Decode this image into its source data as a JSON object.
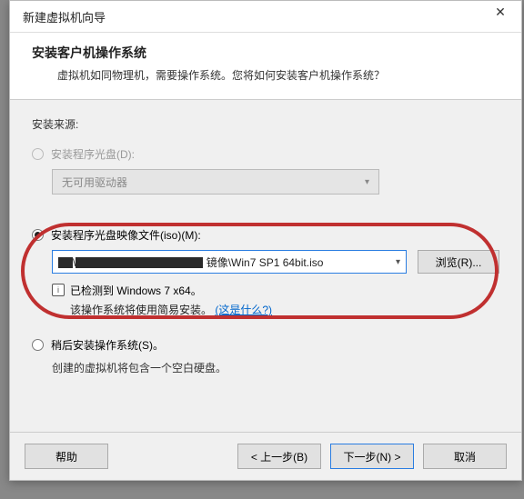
{
  "titlebar": {
    "title": "新建虚拟机向导"
  },
  "header": {
    "title": "安装客户机操作系统",
    "subtitle": "虚拟机如同物理机，需要操作系统。您将如何安装客户机操作系统？"
  },
  "content": {
    "source_label": "安装来源:",
    "opt_disc": {
      "label": "安装程序光盘(D):",
      "dropdown": "无可用驱动器"
    },
    "opt_iso": {
      "label": "安装程序光盘映像文件(iso)(M):",
      "path_prefix": "镜像\\Win7 SP1 64bit.iso",
      "browse": "浏览(R)..."
    },
    "detected": {
      "text": "已检测到 Windows 7 x64。",
      "sub_a": "该操作系统将使用简易安装。",
      "link": "(这是什么?)"
    },
    "opt_later": {
      "label": "稍后安装操作系统(S)。",
      "sub": "创建的虚拟机将包含一个空白硬盘。"
    }
  },
  "buttons": {
    "help": "帮助",
    "back": "< 上一步(B)",
    "next": "下一步(N) >",
    "cancel": "取消"
  }
}
